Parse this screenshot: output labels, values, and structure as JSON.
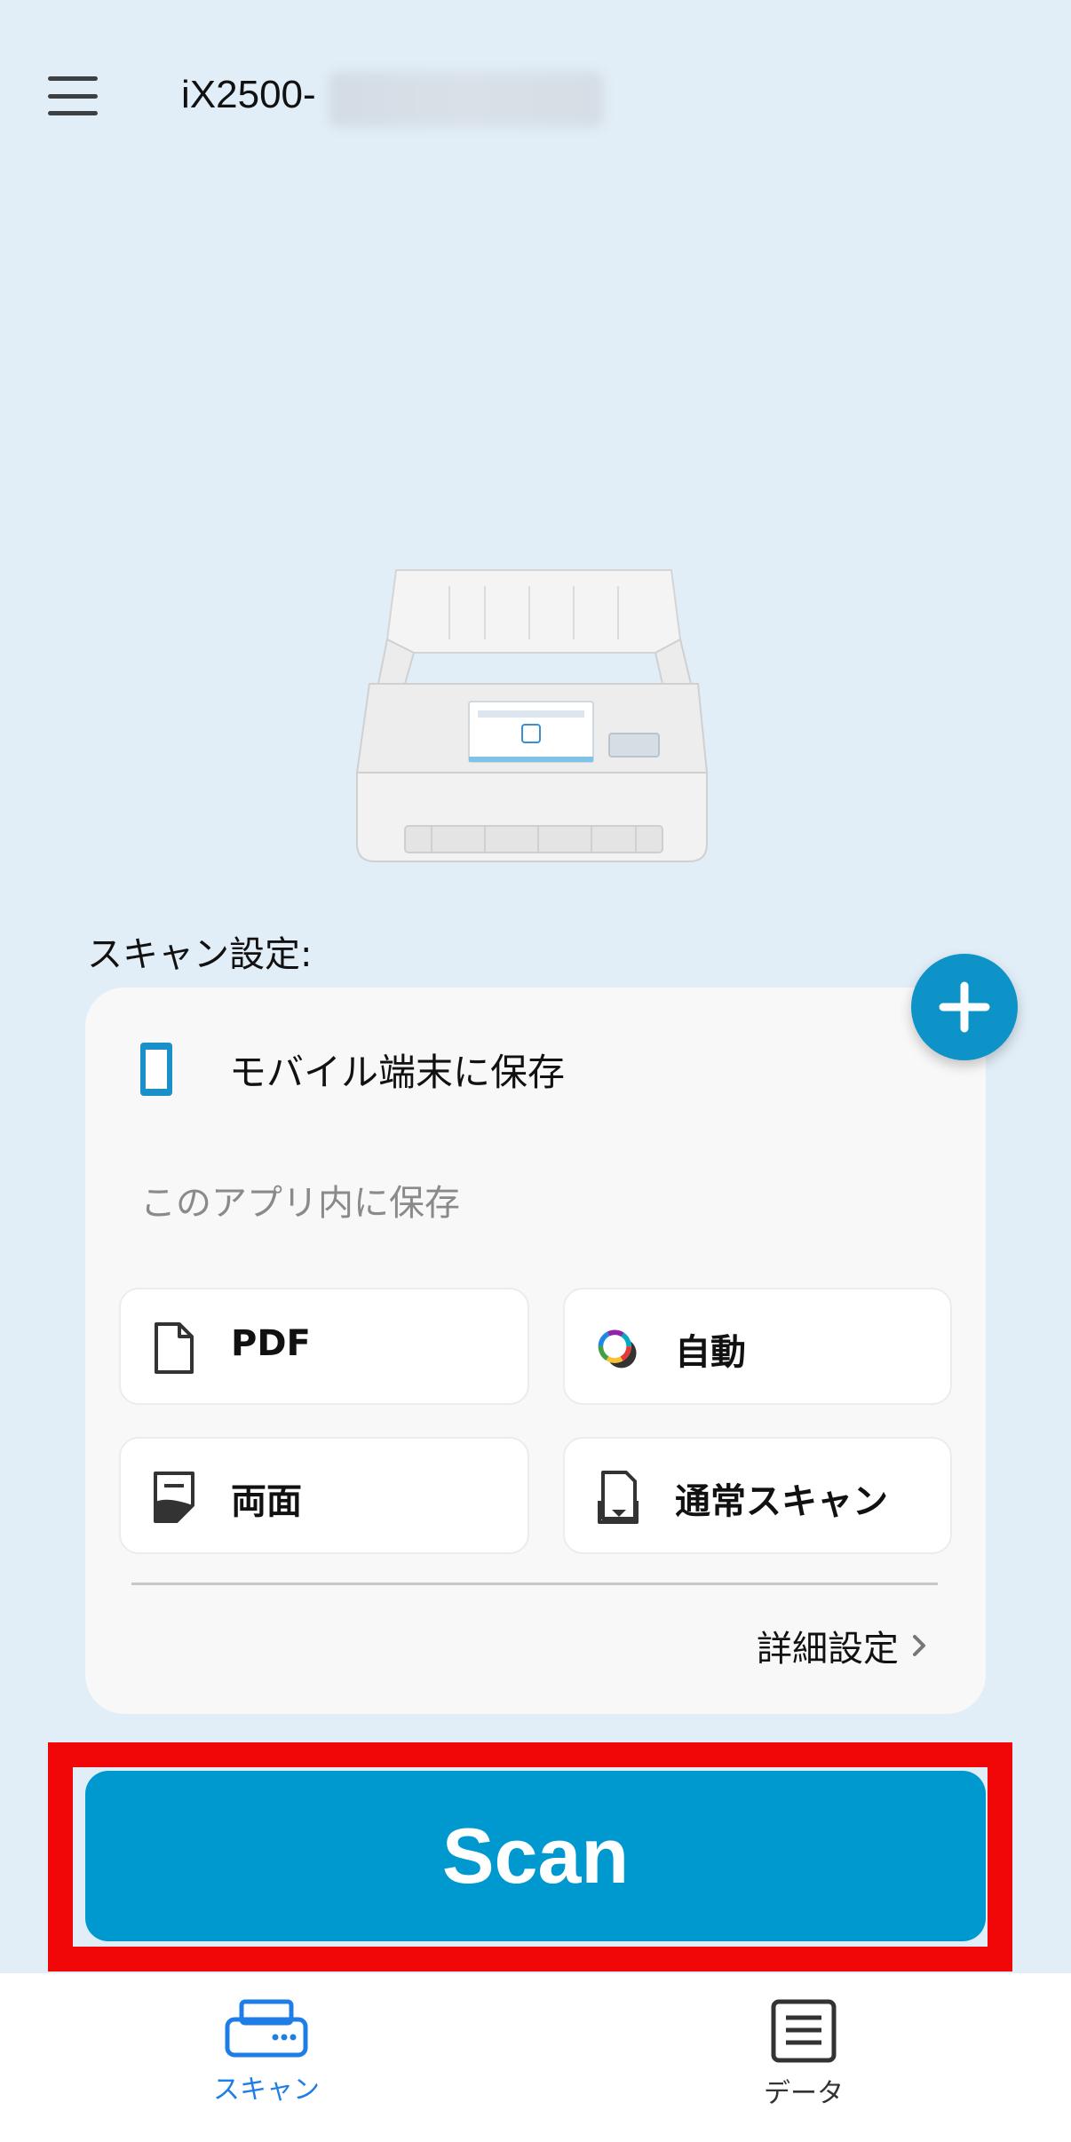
{
  "header": {
    "menu_icon": "hamburger-menu-icon",
    "device_name": "iX2500-"
  },
  "settings": {
    "label": "スキャン設定:",
    "add_icon": "plus-icon",
    "destination": {
      "icon": "mobile-device-icon",
      "label": "モバイル端末に保存"
    },
    "save_location": "このアプリ内に保存",
    "options": [
      {
        "icon": "document-icon",
        "label": "PDF"
      },
      {
        "icon": "color-auto-icon",
        "label": "自動"
      },
      {
        "icon": "duplex-icon",
        "label": "両面"
      },
      {
        "icon": "feed-mode-icon",
        "label": "通常スキャン"
      }
    ],
    "advanced": "詳細設定"
  },
  "scan_button": {
    "label": "Scan"
  },
  "colors": {
    "accent": "#0099cf",
    "highlight": "#f10707",
    "nav_active": "#1f7de6"
  },
  "bottom_nav": [
    {
      "icon": "scanner-icon",
      "label": "スキャン",
      "active": true
    },
    {
      "icon": "list-document-icon",
      "label": "データ",
      "active": false
    }
  ]
}
